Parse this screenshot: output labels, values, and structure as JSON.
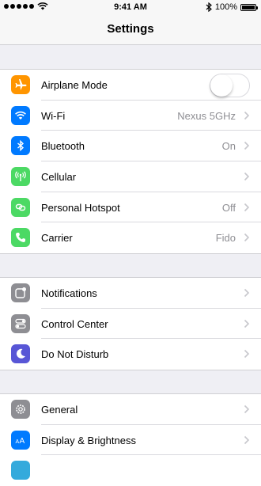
{
  "status_bar": {
    "time": "9:41 AM",
    "battery": "100%",
    "signal_dots": 5,
    "battery_level": 1.0
  },
  "nav": {
    "title": "Settings"
  },
  "colors": {
    "airplane": "#ff9500",
    "wifi": "#007aff",
    "bluetooth": "#007aff",
    "cellular": "#4cd964",
    "hotspot": "#4cd964",
    "carrier": "#4cd964",
    "notifications": "#8e8e93",
    "control_center": "#8e8e93",
    "dnd": "#5856d6",
    "general": "#8e8e93",
    "display": "#007aff"
  },
  "groups": [
    {
      "rows": [
        {
          "label": "Airplane Mode",
          "icon": "airplane-icon",
          "accessory": "toggle",
          "on": false
        },
        {
          "label": "Wi-Fi",
          "icon": "wifi-icon",
          "value": "Nexus 5GHz"
        },
        {
          "label": "Bluetooth",
          "icon": "bluetooth-icon",
          "value": "On"
        },
        {
          "label": "Cellular",
          "icon": "cellular-icon",
          "value": ""
        },
        {
          "label": "Personal Hotspot",
          "icon": "hotspot-icon",
          "value": "Off"
        },
        {
          "label": "Carrier",
          "icon": "phone-icon",
          "value": "Fido"
        }
      ]
    },
    {
      "rows": [
        {
          "label": "Notifications",
          "icon": "notifications-icon"
        },
        {
          "label": "Control Center",
          "icon": "control-center-icon"
        },
        {
          "label": "Do Not Disturb",
          "icon": "moon-icon"
        }
      ]
    },
    {
      "rows": [
        {
          "label": "General",
          "icon": "gear-icon"
        },
        {
          "label": "Display & Brightness",
          "icon": "display-icon"
        }
      ]
    }
  ]
}
